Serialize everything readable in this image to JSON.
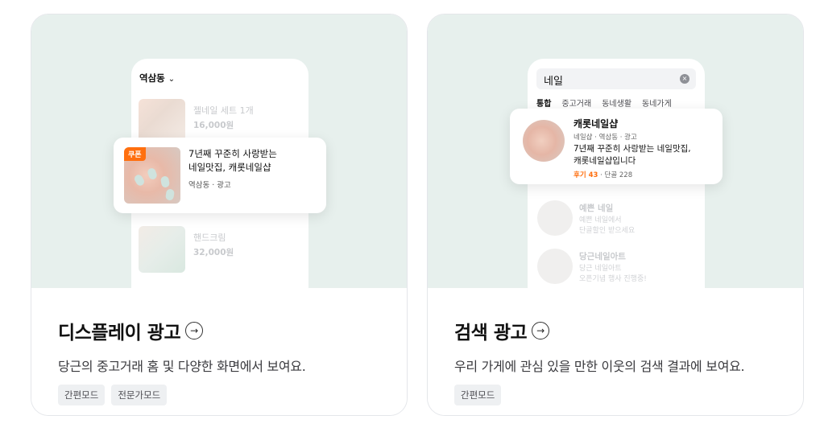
{
  "display_card": {
    "title": "디스플레이 광고",
    "arrow": "→",
    "description": "당근의 중고거래 홈 및 다양한 화면에서 보여요.",
    "tags": [
      "간편모드",
      "전문가모드"
    ],
    "mock": {
      "location": "역삼동",
      "chevron": "⌄",
      "items": [
        {
          "name": "젤네일 세트 1개",
          "price": "16,000원"
        },
        {
          "name": "핸드크림",
          "price": "32,000원"
        }
      ],
      "ad": {
        "badge": "쿠폰",
        "line1": "7년째 꾸준히 사랑받는",
        "line2": "네일맛집, 캐롯네일샵",
        "sub": "역삼동 · 광고"
      }
    }
  },
  "search_card": {
    "title": "검색 광고",
    "arrow": "→",
    "description": "우리 가게에 관심 있을 만한 이웃의 검색 결과에 보여요.",
    "tags": [
      "간편모드"
    ],
    "mock": {
      "query": "네일",
      "clear": "×",
      "tabs": [
        "통합",
        "중고거래",
        "동네생활",
        "동네가게"
      ],
      "ad": {
        "name": "캐롯네일샵",
        "category": "네일샵 · 역삼동 · 광고",
        "line1": "7년째 꾸준히 사랑받는 네일맛집,",
        "line2": "캐롯네일샵입니다",
        "review_label": "후기 43",
        "regulars": " · 단골 228"
      },
      "shops": [
        {
          "name": "예쁜 네일",
          "l1": "예쁜 네일에서",
          "l2": "단골할인 받으세요"
        },
        {
          "name": "당근네일아트",
          "l1": "당근 네일아트",
          "l2": "오픈기념 행사 진행중!"
        }
      ]
    }
  },
  "colors": {
    "accent": "#ff6f0f",
    "hero_bg": "#e7f0ed"
  }
}
